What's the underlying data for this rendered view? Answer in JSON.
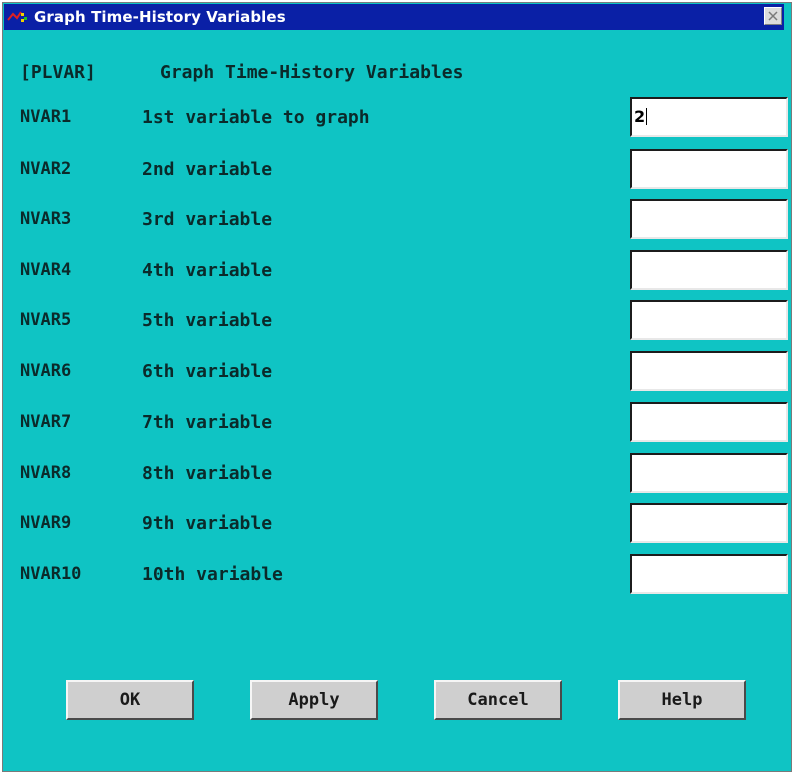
{
  "window": {
    "title": "Graph Time-History Variables"
  },
  "header": {
    "command": "[PLVAR]",
    "description": "Graph Time-History Variables"
  },
  "fields": [
    {
      "code": "NVAR1",
      "label": "1st variable to graph",
      "value": "2"
    },
    {
      "code": "NVAR2",
      "label": "2nd variable",
      "value": ""
    },
    {
      "code": "NVAR3",
      "label": "3rd variable",
      "value": ""
    },
    {
      "code": "NVAR4",
      "label": "4th variable",
      "value": ""
    },
    {
      "code": "NVAR5",
      "label": "5th variable",
      "value": ""
    },
    {
      "code": "NVAR6",
      "label": "6th variable",
      "value": ""
    },
    {
      "code": "NVAR7",
      "label": "7th variable",
      "value": ""
    },
    {
      "code": "NVAR8",
      "label": "8th variable",
      "value": ""
    },
    {
      "code": "NVAR9",
      "label": "9th variable",
      "value": ""
    },
    {
      "code": "NVAR10",
      "label": "10th variable",
      "value": ""
    }
  ],
  "buttons": {
    "ok": "OK",
    "apply": "Apply",
    "cancel": "Cancel",
    "help": "Help"
  },
  "colors": {
    "background": "#0fc4c4",
    "titlebar": "#0a20a6",
    "button": "#cfcfcf"
  },
  "icons": {
    "app": "ansys-app-icon",
    "close": "close-icon"
  }
}
